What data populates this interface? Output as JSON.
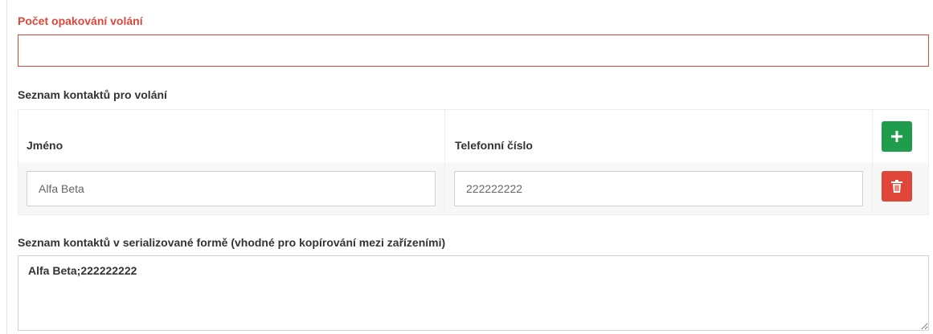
{
  "retry_count": {
    "label": "Počet opakování volání",
    "value": ""
  },
  "contacts": {
    "label": "Seznam kontaktů pro volání",
    "columns": {
      "name": "Jméno",
      "phone": "Telefonní číslo"
    },
    "rows": [
      {
        "name": "Alfa Beta",
        "phone": "222222222"
      }
    ],
    "add_icon": "plus-icon",
    "delete_icon": "trash-icon",
    "colors": {
      "add": "#1f9d4c",
      "delete": "#e0463a",
      "error": "#e0463a"
    }
  },
  "serialized": {
    "label": "Seznam kontaktů v serializované formě (vhodné pro kopírování mezi zařízeními)",
    "value": "Alfa Beta;222222222"
  }
}
